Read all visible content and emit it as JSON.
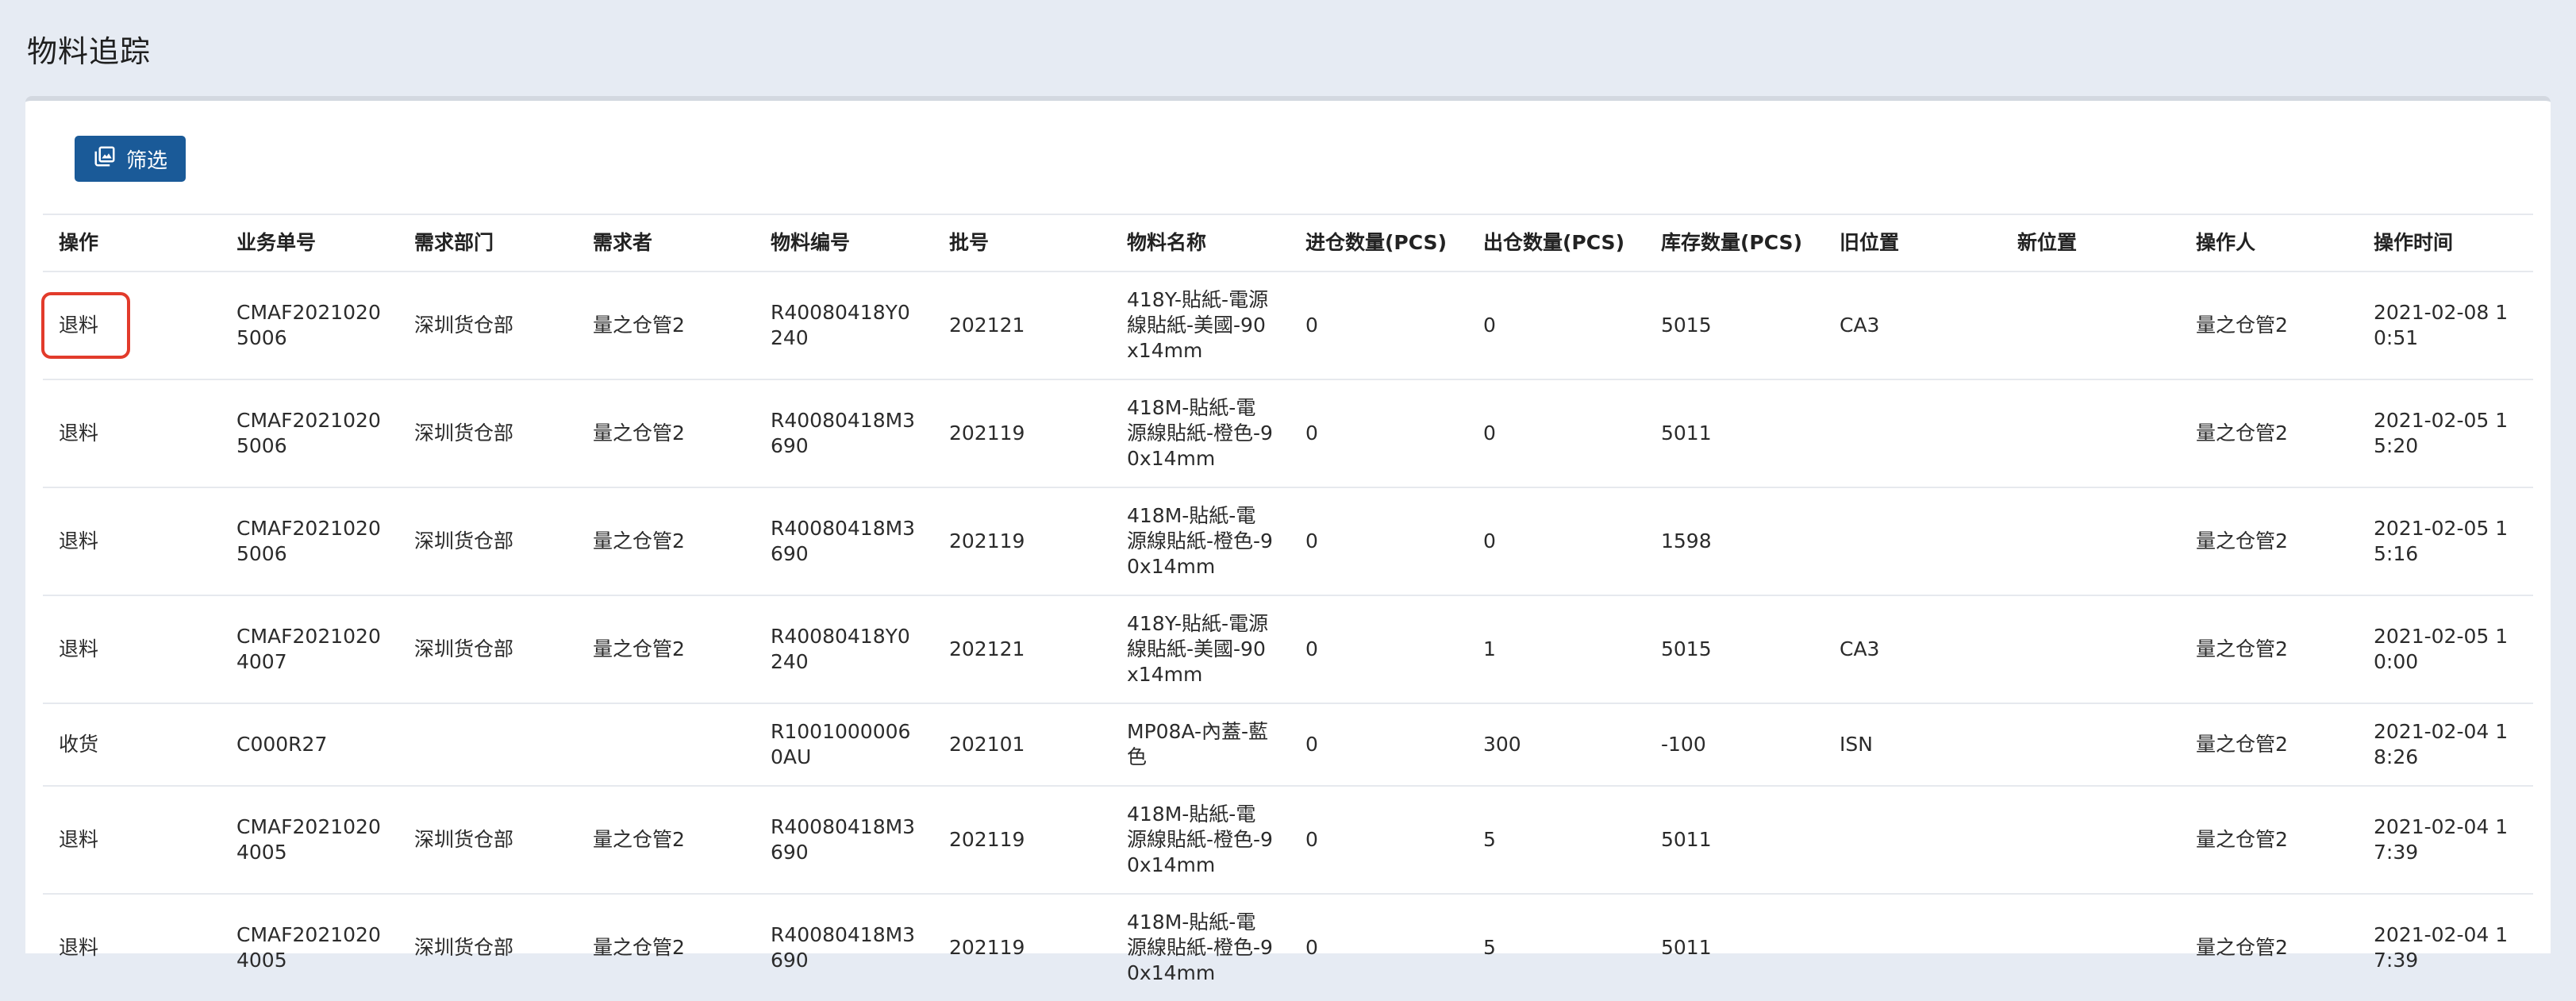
{
  "page": {
    "title": "物料追踪"
  },
  "toolbar": {
    "filter_label": "筛选",
    "filter_icon": "filter-image-icon"
  },
  "colors": {
    "primary": "#1a5a98",
    "highlight": "#e23b2b",
    "background": "#e6ebf3"
  },
  "table": {
    "columns": [
      "操作",
      "业务单号",
      "需求部门",
      "需求者",
      "物料编号",
      "批号",
      "物料名称",
      "进仓数量(PCS)",
      "出仓数量(PCS)",
      "库存数量(PCS)",
      "旧位置",
      "新位置",
      "操作人",
      "操作时间"
    ],
    "rows": [
      [
        "退料",
        "CMAF20210205006",
        "深圳货仓部",
        "量之仓管2",
        "R40080418Y0240",
        "202121",
        "418Y-貼紙-電源線貼紙-美國-90x14mm",
        "0",
        "0",
        "5015",
        "CA3",
        "",
        "量之仓管2",
        "2021-02-08 10:51"
      ],
      [
        "退料",
        "CMAF20210205006",
        "深圳货仓部",
        "量之仓管2",
        "R40080418M3690",
        "202119",
        "418M-貼紙-電源線貼紙-橙色-90x14mm",
        "0",
        "0",
        "5011",
        "",
        "",
        "量之仓管2",
        "2021-02-05 15:20"
      ],
      [
        "退料",
        "CMAF20210205006",
        "深圳货仓部",
        "量之仓管2",
        "R40080418M3690",
        "202119",
        "418M-貼紙-電源線貼紙-橙色-90x14mm",
        "0",
        "0",
        "1598",
        "",
        "",
        "量之仓管2",
        "2021-02-05 15:16"
      ],
      [
        "退料",
        "CMAF20210204007",
        "深圳货仓部",
        "量之仓管2",
        "R40080418Y0240",
        "202121",
        "418Y-貼紙-電源線貼紙-美國-90x14mm",
        "0",
        "1",
        "5015",
        "CA3",
        "",
        "量之仓管2",
        "2021-02-05 10:00"
      ],
      [
        "收货",
        "C000R27",
        "",
        "",
        "R10010000060AU",
        "202101",
        "MP08A-內蓋-藍色",
        "0",
        "300",
        "-100",
        "ISN",
        "",
        "量之仓管2",
        "2021-02-04 18:26"
      ],
      [
        "退料",
        "CMAF20210204005",
        "深圳货仓部",
        "量之仓管2",
        "R40080418M3690",
        "202119",
        "418M-貼紙-電源線貼紙-橙色-90x14mm",
        "0",
        "5",
        "5011",
        "",
        "",
        "量之仓管2",
        "2021-02-04 17:39"
      ],
      [
        "退料",
        "CMAF20210204005",
        "深圳货仓部",
        "量之仓管2",
        "R40080418M3690",
        "202119",
        "418M-貼紙-電源線貼紙-橙色-90x14mm",
        "0",
        "5",
        "5011",
        "",
        "",
        "量之仓管2",
        "2021-02-04 17:39"
      ]
    ]
  }
}
